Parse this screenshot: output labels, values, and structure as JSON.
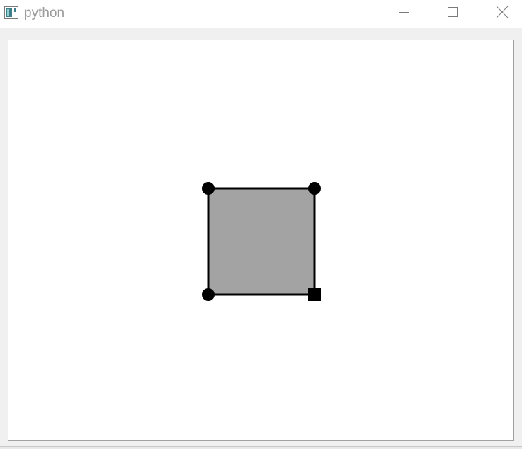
{
  "window": {
    "title": "python",
    "icon": "python-app-icon",
    "controls": {
      "minimize": "minimize-icon",
      "maximize": "maximize-icon",
      "close": "close-icon"
    }
  },
  "canvas": {
    "background": "#ffffff",
    "shape": {
      "type": "square",
      "fill": "#a3a3a3",
      "stroke": "#000000",
      "handles": [
        {
          "corner": "top-left",
          "style": "circle"
        },
        {
          "corner": "top-right",
          "style": "circle"
        },
        {
          "corner": "bottom-left",
          "style": "circle"
        },
        {
          "corner": "bottom-right",
          "style": "square"
        }
      ]
    }
  }
}
